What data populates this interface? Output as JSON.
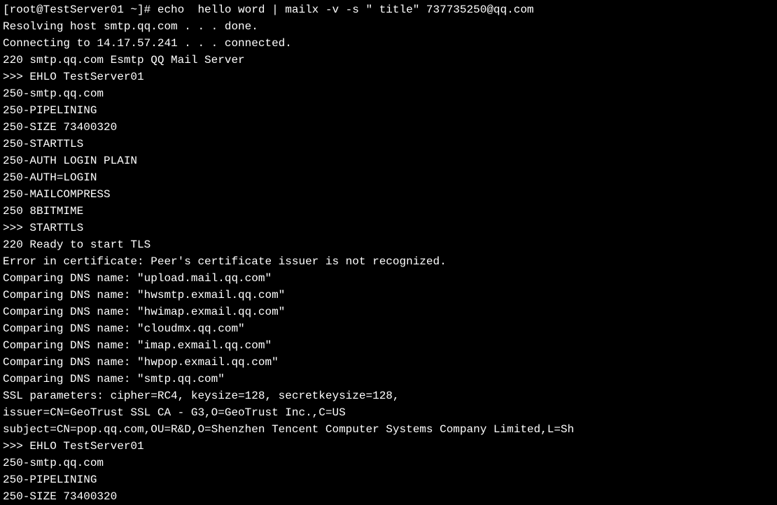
{
  "terminal": {
    "lines": [
      "[root@TestServer01 ~]# echo  hello word | mailx -v -s \" title\" 737735250@qq.com",
      "Resolving host smtp.qq.com . . . done.",
      "Connecting to 14.17.57.241 . . . connected.",
      "220 smtp.qq.com Esmtp QQ Mail Server",
      ">>> EHLO TestServer01",
      "250-smtp.qq.com",
      "250-PIPELINING",
      "250-SIZE 73400320",
      "250-STARTTLS",
      "250-AUTH LOGIN PLAIN",
      "250-AUTH=LOGIN",
      "250-MAILCOMPRESS",
      "250 8BITMIME",
      ">>> STARTTLS",
      "220 Ready to start TLS",
      "Error in certificate: Peer's certificate issuer is not recognized.",
      "Comparing DNS name: \"upload.mail.qq.com\"",
      "Comparing DNS name: \"hwsmtp.exmail.qq.com\"",
      "Comparing DNS name: \"hwimap.exmail.qq.com\"",
      "Comparing DNS name: \"cloudmx.qq.com\"",
      "Comparing DNS name: \"imap.exmail.qq.com\"",
      "Comparing DNS name: \"hwpop.exmail.qq.com\"",
      "Comparing DNS name: \"smtp.qq.com\"",
      "SSL parameters: cipher=RC4, keysize=128, secretkeysize=128,",
      "issuer=CN=GeoTrust SSL CA - G3,O=GeoTrust Inc.,C=US",
      "subject=CN=pop.qq.com,OU=R&D,O=Shenzhen Tencent Computer Systems Company Limited,L=Sh",
      ">>> EHLO TestServer01",
      "250-smtp.qq.com",
      "250-PIPELINING",
      "250-SIZE 73400320"
    ]
  }
}
